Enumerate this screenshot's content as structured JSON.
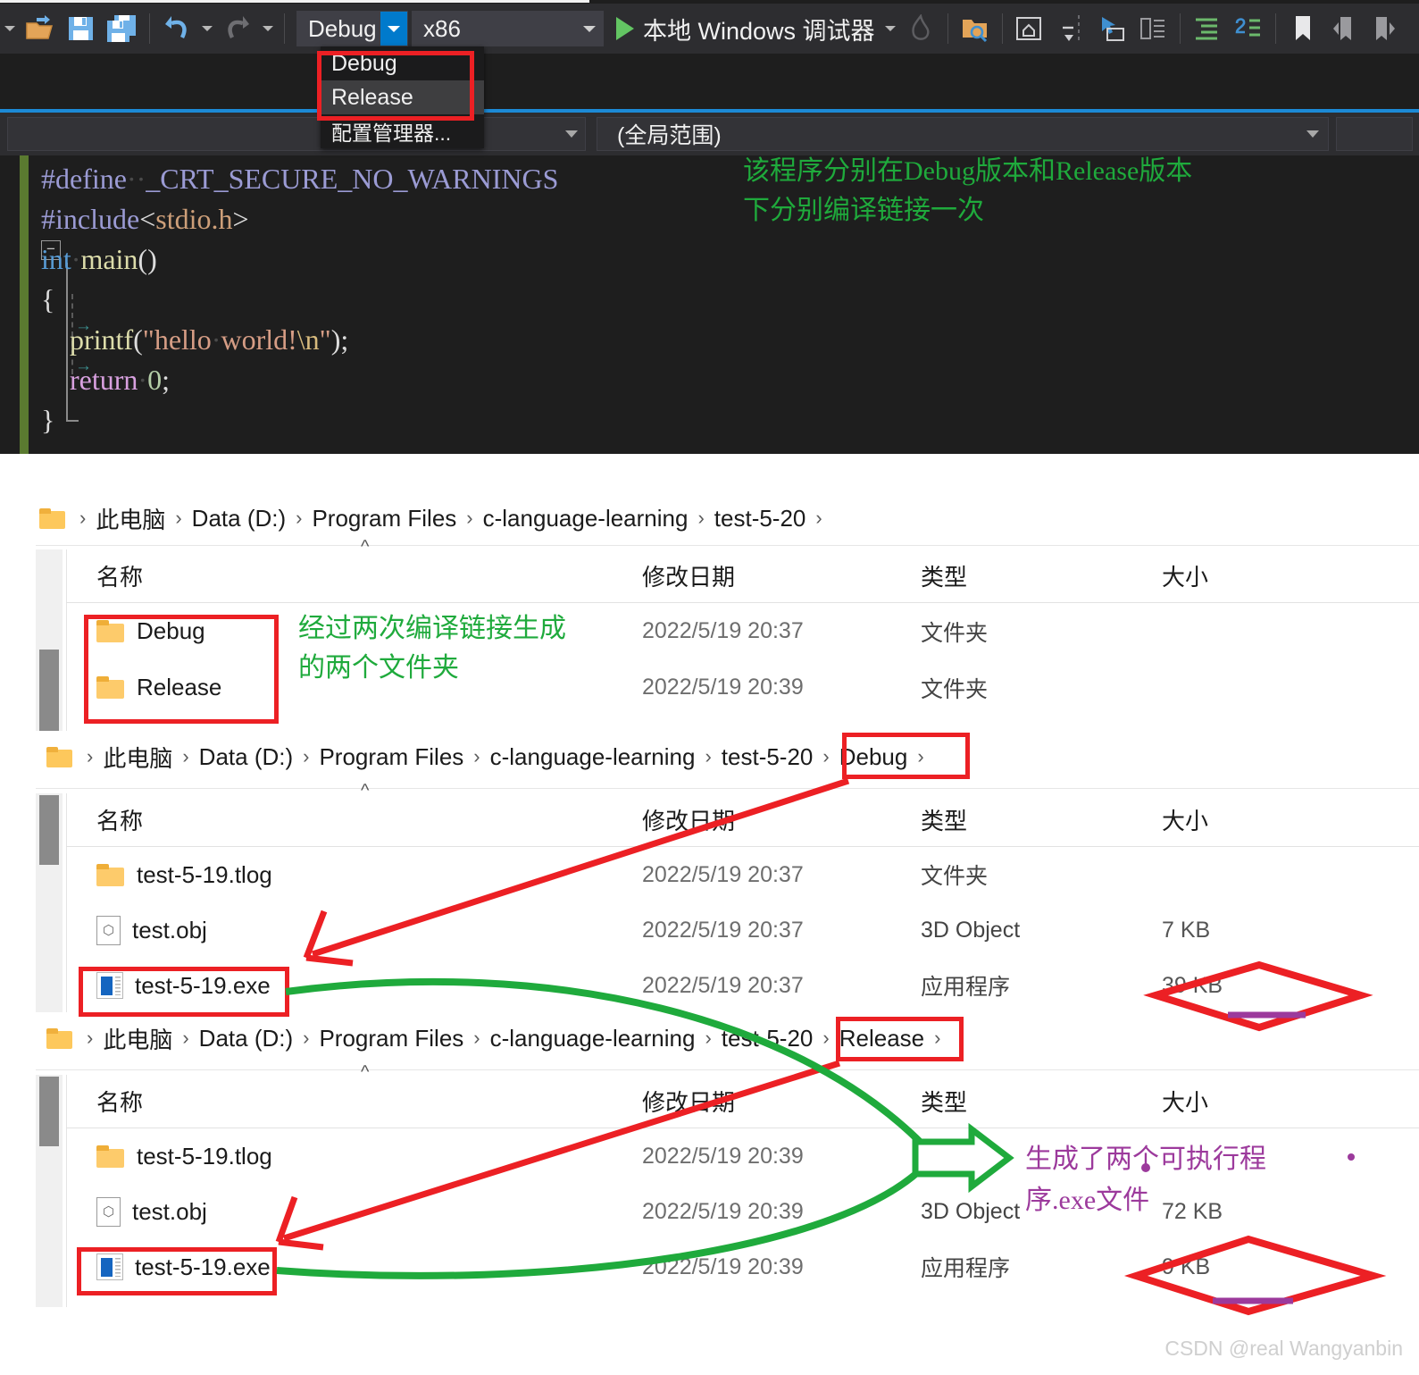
{
  "ide": {
    "toolbar": {
      "config_value": "Debug",
      "platform_value": "x86",
      "run_label": "本地 Windows 调试器",
      "dropdown_items": [
        {
          "label": "Debug",
          "highlighted": false
        },
        {
          "label": "Release",
          "highlighted": true
        },
        {
          "label": "配置管理器...",
          "highlighted": false
        }
      ]
    },
    "scope_bar": {
      "left_value": "",
      "right_value": "(全局范围)"
    },
    "code_lines": [
      "#define  _CRT_SECURE_NO_WARNINGS",
      "#include<stdio.h>",
      "int main()",
      "{",
      "    printf(\"hello world!\\n\");",
      "    return 0;",
      "}"
    ],
    "annotation": "该程序分别在Debug版本和Release版本\n下分别编译链接一次"
  },
  "explorer1": {
    "breadcrumb": {
      "segments": [
        "此电脑",
        "Data (D:)",
        "Program Files",
        "c-language-learning",
        "test-5-20"
      ],
      "separator": "›"
    },
    "columns": [
      "名称",
      "修改日期",
      "类型",
      "大小"
    ],
    "rows": [
      {
        "icon": "folder-icon",
        "name": "Debug",
        "date": "2022/5/19 20:37",
        "type": "文件夹",
        "size": ""
      },
      {
        "icon": "folder-icon",
        "name": "Release",
        "date": "2022/5/19 20:39",
        "type": "文件夹",
        "size": ""
      }
    ],
    "annotation": "经过两次编译链接生成\n的两个文件夹"
  },
  "explorer2": {
    "breadcrumb": {
      "segments": [
        "此电脑",
        "Data (D:)",
        "Program Files",
        "c-language-learning",
        "test-5-20",
        "Debug"
      ],
      "highlighted_segment": "Debug",
      "separator": "›"
    },
    "columns": [
      "名称",
      "修改日期",
      "类型",
      "大小"
    ],
    "rows": [
      {
        "icon": "folder-icon",
        "name": "test-5-19.tlog",
        "date": "2022/5/19 20:37",
        "type": "文件夹",
        "size": ""
      },
      {
        "icon": "doc-icon",
        "name": "test.obj",
        "date": "2022/5/19 20:37",
        "type": "3D Object",
        "size": "7 KB"
      },
      {
        "icon": "exe-icon",
        "name": "test-5-19.exe",
        "date": "2022/5/19 20:37",
        "type": "应用程序",
        "size": "39 KB"
      }
    ]
  },
  "explorer3": {
    "breadcrumb": {
      "segments": [
        "此电脑",
        "Data (D:)",
        "Program Files",
        "c-language-learning",
        "test-5-20",
        "Release"
      ],
      "highlighted_segment": "Release",
      "separator": "›"
    },
    "columns": [
      "名称",
      "修改日期",
      "类型",
      "大小"
    ],
    "rows": [
      {
        "icon": "folder-icon",
        "name": "test-5-19.tlog",
        "date": "2022/5/19 20:39",
        "type": "文件夹",
        "size": ""
      },
      {
        "icon": "doc-icon",
        "name": "test.obj",
        "date": "2022/5/19 20:39",
        "type": "3D Object",
        "size": "72 KB"
      },
      {
        "icon": "exe-icon",
        "name": "test-5-19.exe",
        "date": "2022/5/19 20:39",
        "type": "应用程序",
        "size": "9 KB"
      }
    ],
    "annotation": "生成了两个可执行程\n序.exe文件"
  },
  "watermark": "CSDN @real Wangyanbin",
  "colors": {
    "annotation_red": "#ec2024",
    "annotation_green": "#1faa3c",
    "annotation_purple": "#9c3a9c",
    "ide_background": "#1e1e1e",
    "ide_toolbar": "#2d2d30",
    "accent_blue": "#007acc"
  }
}
